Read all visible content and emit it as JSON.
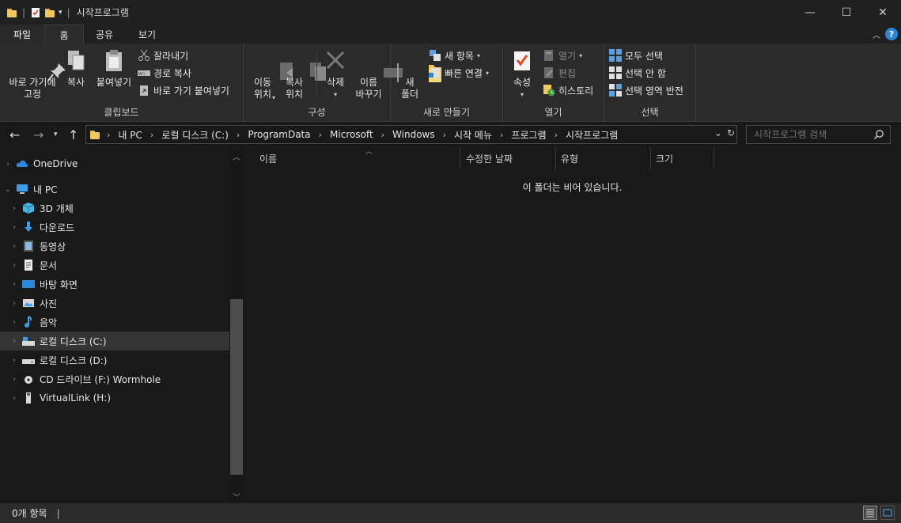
{
  "window": {
    "title": "시작프로그램",
    "controls": {
      "minimize": "—",
      "maximize": "☐",
      "close": "✕"
    }
  },
  "ribbon_tabs": [
    "파일",
    "홈",
    "공유",
    "보기"
  ],
  "ribbon": {
    "clipboard": {
      "label": "클립보드",
      "pin": "바로 가기에\n고정",
      "copy": "복사",
      "paste": "붙여넣기",
      "cut": "잘라내기",
      "copy_path": "경로 복사",
      "paste_shortcut": "바로 가기 붙여넣기"
    },
    "organize": {
      "label": "구성",
      "move_to": "이동\n위치",
      "copy_to": "복사\n위치",
      "delete": "삭제",
      "rename": "이름\n바꾸기"
    },
    "new": {
      "label": "새로 만들기",
      "new_folder": "새\n폴더",
      "new_item": "새 항목",
      "easy_access": "빠른 연결"
    },
    "open": {
      "label": "열기",
      "properties": "속성",
      "open": "열기",
      "edit": "편집",
      "history": "히스토리"
    },
    "select": {
      "label": "선택",
      "select_all": "모두 선택",
      "select_none": "선택 안 함",
      "invert": "선택 영역 반전"
    }
  },
  "address": {
    "crumbs": [
      "내 PC",
      "로컬 디스크 (C:)",
      "ProgramData",
      "Microsoft",
      "Windows",
      "시작 메뉴",
      "프로그램",
      "시작프로그램"
    ]
  },
  "search": {
    "placeholder": "시작프로그램 검색"
  },
  "nav": {
    "items": [
      {
        "label": "OneDrive",
        "icon": "onedrive-icon"
      },
      {
        "label": "내 PC",
        "icon": "pc-icon"
      },
      {
        "label": "3D 개체",
        "icon": "3d-objects-icon"
      },
      {
        "label": "다운로드",
        "icon": "download-icon"
      },
      {
        "label": "동영상",
        "icon": "video-icon"
      },
      {
        "label": "문서",
        "icon": "document-icon"
      },
      {
        "label": "바탕 화면",
        "icon": "desktop-icon"
      },
      {
        "label": "사진",
        "icon": "picture-icon"
      },
      {
        "label": "음악",
        "icon": "music-icon"
      },
      {
        "label": "로컬 디스크 (C:)",
        "icon": "drive-c-icon"
      },
      {
        "label": "로컬 디스크 (D:)",
        "icon": "drive-d-icon"
      },
      {
        "label": "CD 드라이브 (F:) Wormhole",
        "icon": "cd-drive-icon"
      },
      {
        "label": "VirtualLink (H:)",
        "icon": "usb-drive-icon"
      }
    ]
  },
  "columns": [
    "이름",
    "수정한 날짜",
    "유형",
    "크기"
  ],
  "empty_message": "이 폴더는 비어 있습니다.",
  "status": {
    "count": "0개 항목",
    "cursor": "|"
  },
  "colors": {
    "background": "#191919",
    "ribbon": "#2b2b2b",
    "accent": "#2a86d8",
    "folder": "#f2c85c"
  }
}
